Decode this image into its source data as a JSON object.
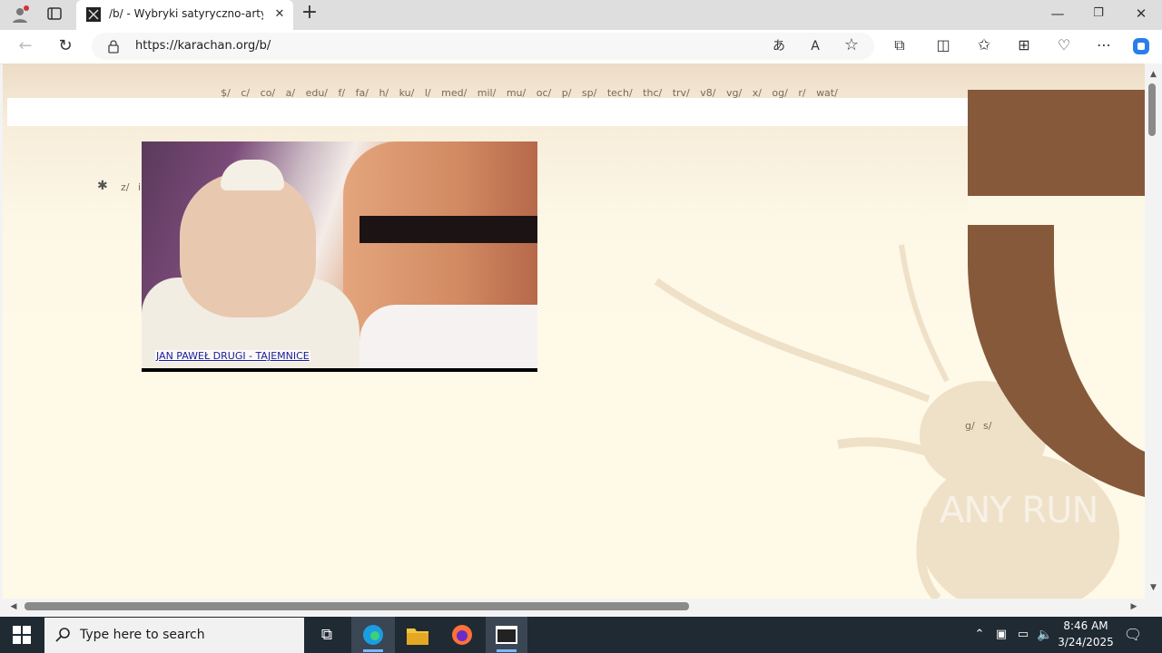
{
  "browser": {
    "tab_title": "/b/ - Wybryki satyryczno-artysty",
    "url": "https://karachan.org/b/",
    "new_tab_label": "+",
    "window_controls": {
      "minimize": "—",
      "restore": "❐",
      "close": "✕"
    }
  },
  "page": {
    "board_nav": [
      "$/",
      "c/",
      "co/",
      "a/",
      "edu/",
      "f/",
      "fa/",
      "h/",
      "ku/",
      "l/",
      "med/",
      "mil/",
      "mu/",
      "oc/",
      "p/",
      "sp/",
      "tech/",
      "thc/",
      "trv/",
      "v8/",
      "vg/",
      "x/",
      "og/",
      "r/",
      "wat/"
    ],
    "left_nav_z": "z/",
    "left_nav_i": "i",
    "banner_link": "JAN PAWEŁ DRUGI - TAJEMNICE",
    "right_nav_g": "g/",
    "right_nav_s": "s/",
    "watermark": "ANY RUN"
  },
  "taskbar": {
    "search_placeholder": "Type here to search",
    "time": "8:46 AM",
    "date": "3/24/2025"
  },
  "colors": {
    "side_brown": "#86593a",
    "page_bg": "#fff9e8"
  }
}
